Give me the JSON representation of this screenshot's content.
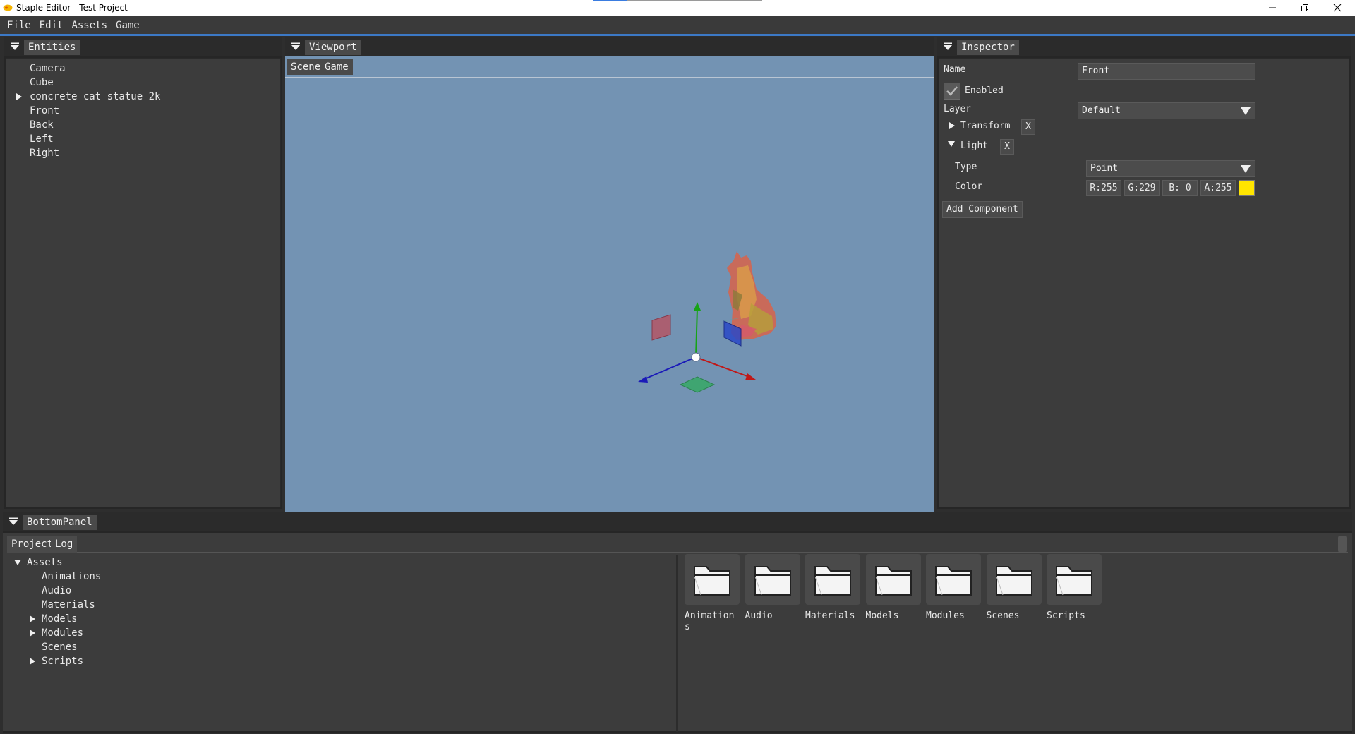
{
  "window": {
    "title": "Staple Editor - Test Project",
    "minimize": "—",
    "restore": "❐",
    "close": "✕"
  },
  "menu": [
    "File",
    "Edit",
    "Assets",
    "Game"
  ],
  "entities": {
    "tab": "Entities",
    "items": [
      {
        "label": "Camera",
        "expandable": false
      },
      {
        "label": "Cube",
        "expandable": false
      },
      {
        "label": "concrete_cat_statue_2k",
        "expandable": true
      },
      {
        "label": "Front",
        "expandable": false
      },
      {
        "label": "Back",
        "expandable": false
      },
      {
        "label": "Left",
        "expandable": false
      },
      {
        "label": "Right",
        "expandable": false
      }
    ]
  },
  "viewport": {
    "tab": "Viewport",
    "subtabs": [
      "Scene",
      "Game"
    ],
    "background": "#7393b3"
  },
  "inspector": {
    "tab": "Inspector",
    "name_label": "Name",
    "name_value": "Front",
    "enabled_label": "Enabled",
    "enabled": true,
    "layer_label": "Layer",
    "layer_value": "Default",
    "transform_label": "Transform",
    "light_label": "Light",
    "remove_label": "X",
    "type_label": "Type",
    "type_value": "Point",
    "color_label": "Color",
    "color": {
      "r": "R:255",
      "g": "G:229",
      "b": "B:  0",
      "a": "A:255",
      "swatch": "#ffe500"
    },
    "add_component": "Add Component"
  },
  "bottom": {
    "tab": "BottomPanel",
    "subtabs": [
      "Project",
      "Log"
    ],
    "tree": [
      {
        "label": "Assets",
        "level": 0,
        "state": "open"
      },
      {
        "label": "Animations",
        "level": 1,
        "state": "none"
      },
      {
        "label": "Audio",
        "level": 1,
        "state": "none"
      },
      {
        "label": "Materials",
        "level": 1,
        "state": "none"
      },
      {
        "label": "Models",
        "level": 1,
        "state": "closed"
      },
      {
        "label": "Modules",
        "level": 1,
        "state": "closed"
      },
      {
        "label": "Scenes",
        "level": 1,
        "state": "none"
      },
      {
        "label": "Scripts",
        "level": 1,
        "state": "closed"
      }
    ],
    "folders": [
      "Animations",
      "Audio",
      "Materials",
      "Models",
      "Modules",
      "Scenes",
      "Scripts"
    ]
  }
}
